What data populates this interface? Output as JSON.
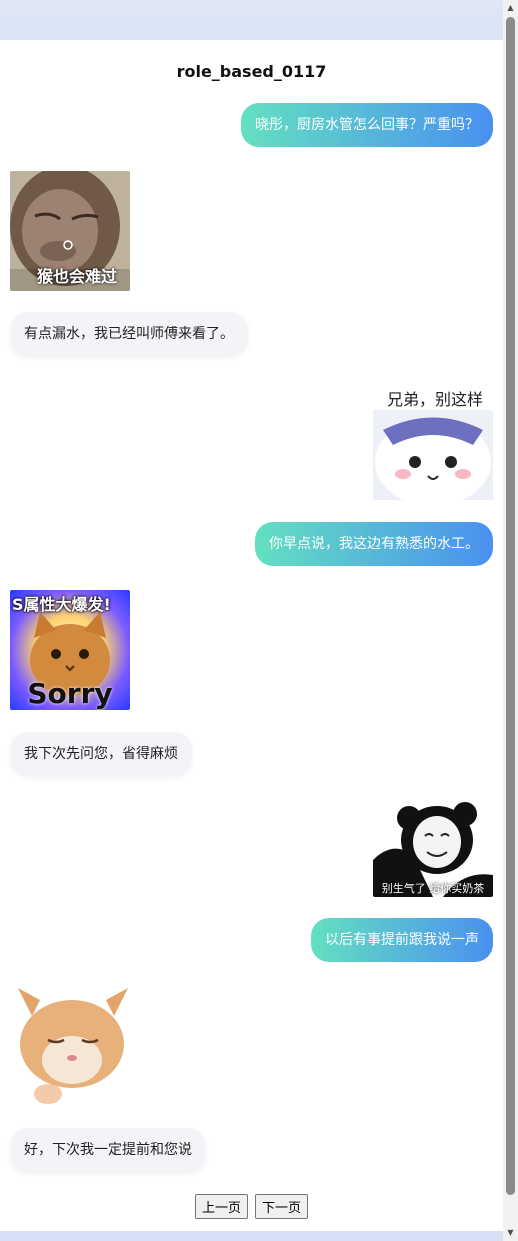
{
  "title": "role_based_0117",
  "messages": [
    {
      "text": "晓彤，厨房水管怎么回事？严重吗？"
    },
    {
      "caption": "猴也会难过"
    },
    {
      "text": "有点漏水，我已经叫师傅来看了。"
    },
    {
      "caption": "兄弟，别这样"
    },
    {
      "text": "你早点说，我这边有熟悉的水工。"
    },
    {
      "caption_top": "S属性大爆发!",
      "caption_bottom": "Sorry"
    },
    {
      "text": "我下次先问您，省得麻烦"
    },
    {
      "caption": "别生气了 给你买奶茶"
    },
    {
      "text": "以后有事提前跟我说一声"
    },
    {
      "text": "好，下次我一定提前和您说"
    }
  ],
  "nav": {
    "prev": "上一页",
    "next": "下一页"
  }
}
